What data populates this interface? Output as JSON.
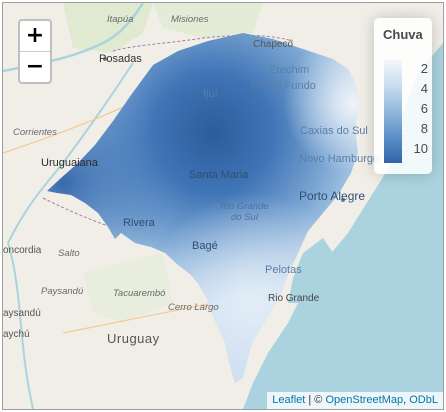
{
  "map": {
    "places": {
      "itapua": "Itapúa",
      "misiones": "Misiones",
      "posadas": "Posadas",
      "chapeco": "Chapecó",
      "erechim": "Erechim",
      "ijui": "Ijuí",
      "passo_fundo": "Passo Fundo",
      "corrientes": "Corrientes",
      "caxias": "Caxias do Sul",
      "novo_hamburgo": "Novo Hamburgo",
      "uruguaiana": "Uruguaiana",
      "santa_maria": "Santa Maria",
      "porto_alegre": "Porto Alegre",
      "rio_grande_do_sul_1": "Rio Grande",
      "rio_grande_do_sul_2": "do Sul",
      "rivera": "Rivera",
      "concordia": "oncordia",
      "salto": "Salto",
      "bage": "Bagé",
      "pelotas": "Pelotas",
      "paysandu": "Paysandú",
      "tacuarembo": "Tacuarembó",
      "rio_grande": "Rio Grande",
      "cerro_largo": "Cerro Largo",
      "aysandu": "aysandú",
      "uruguay": "Uruguay",
      "aychu": "aychú"
    }
  },
  "zoom": {
    "in_label": "+",
    "out_label": "−"
  },
  "legend": {
    "title": "Chuva",
    "ticks": [
      "2",
      "4",
      "6",
      "8",
      "10"
    ],
    "bar_colors": [
      "#f4f8fb",
      "#c9dcee",
      "#92b8dc",
      "#5b8fc8",
      "#2f64a8"
    ]
  },
  "attribution": {
    "leaflet": "Leaflet",
    "separator": " | © ",
    "osm": "OpenStreetMap",
    "comma": ", ",
    "odbl": "ODbL"
  }
}
